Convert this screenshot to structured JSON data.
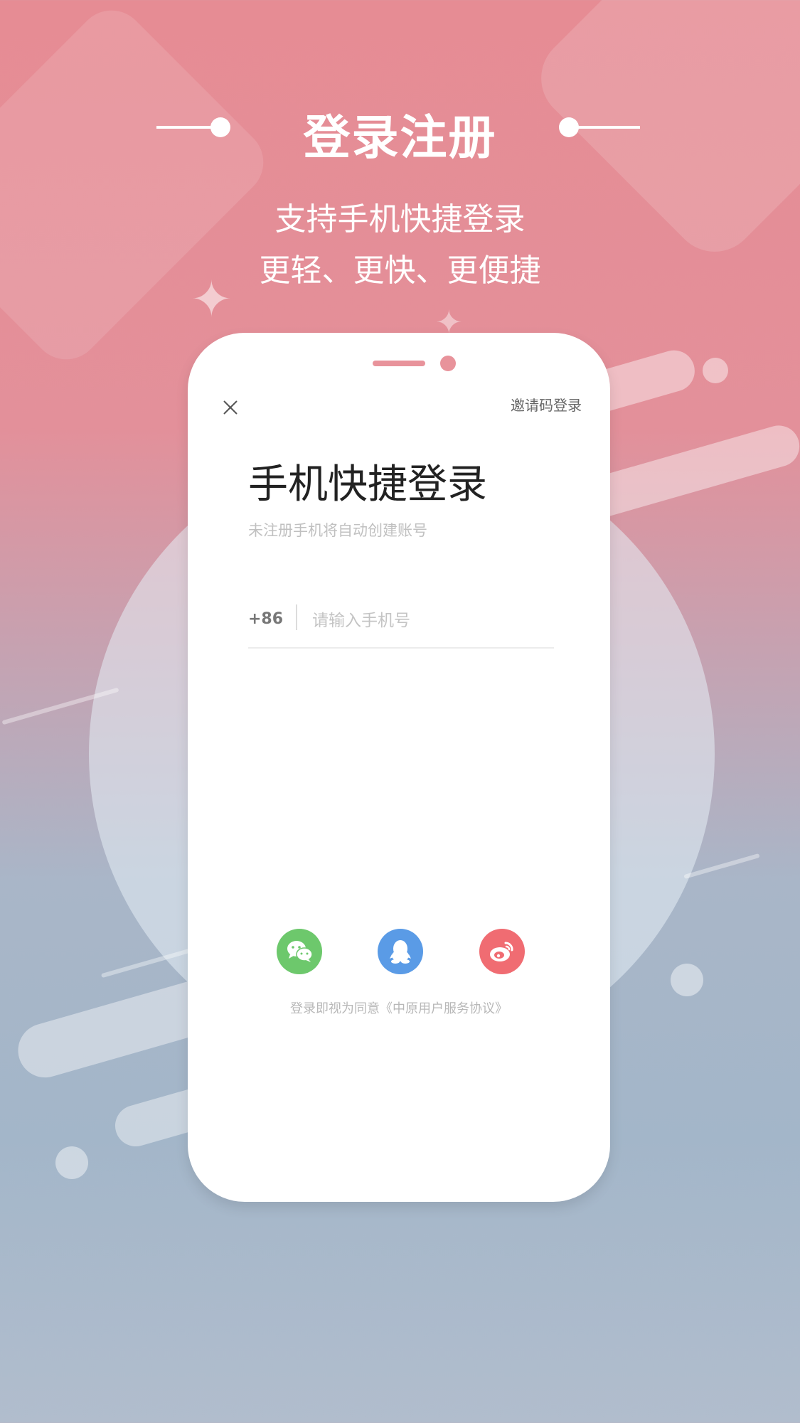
{
  "header": {
    "title": "登录注册",
    "subtitle_line1": "支持手机快捷登录",
    "subtitle_line2": "更轻、更快、更便捷"
  },
  "login_screen": {
    "close_icon": "close-icon",
    "invite_code_login": "邀请码登录",
    "title": "手机快捷登录",
    "hint": "未注册手机将自动创建账号",
    "country_code": "+86",
    "phone_input": {
      "value": "",
      "placeholder": "请输入手机号"
    },
    "social_logins": [
      {
        "name": "wechat",
        "icon": "wechat-icon",
        "color": "#6dc86c"
      },
      {
        "name": "qq",
        "icon": "qq-icon",
        "color": "#5a9be6"
      },
      {
        "name": "weibo",
        "icon": "weibo-icon",
        "color": "#f06c72"
      }
    ],
    "agreement": "登录即视为同意《中原用户服务协议》"
  },
  "colors": {
    "accent_pink": "#e8939b",
    "background_top": "#e68c94",
    "background_bottom": "#b1bdcd"
  }
}
